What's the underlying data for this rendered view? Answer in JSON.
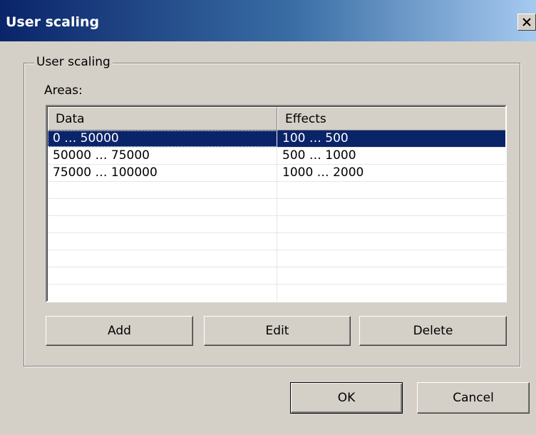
{
  "window": {
    "title": "User scaling",
    "close_symbol": "✕"
  },
  "group": {
    "legend": "User scaling",
    "areas_label": "Areas:"
  },
  "list": {
    "columns": [
      "Data",
      "Effects"
    ],
    "rows": [
      {
        "data": "0 … 50000",
        "effects": "100 … 500",
        "selected": true
      },
      {
        "data": "50000 … 75000",
        "effects": "500 … 1000",
        "selected": false
      },
      {
        "data": "75000 … 100000",
        "effects": "1000 … 2000",
        "selected": false
      }
    ]
  },
  "buttons": {
    "add": "Add",
    "edit": "Edit",
    "delete": "Delete",
    "ok": "OK",
    "cancel": "Cancel"
  },
  "colors": {
    "titlebar_start": "#0a246a",
    "titlebar_end": "#a6caf0",
    "selection": "#0a246a",
    "face": "#d4d0c8"
  }
}
